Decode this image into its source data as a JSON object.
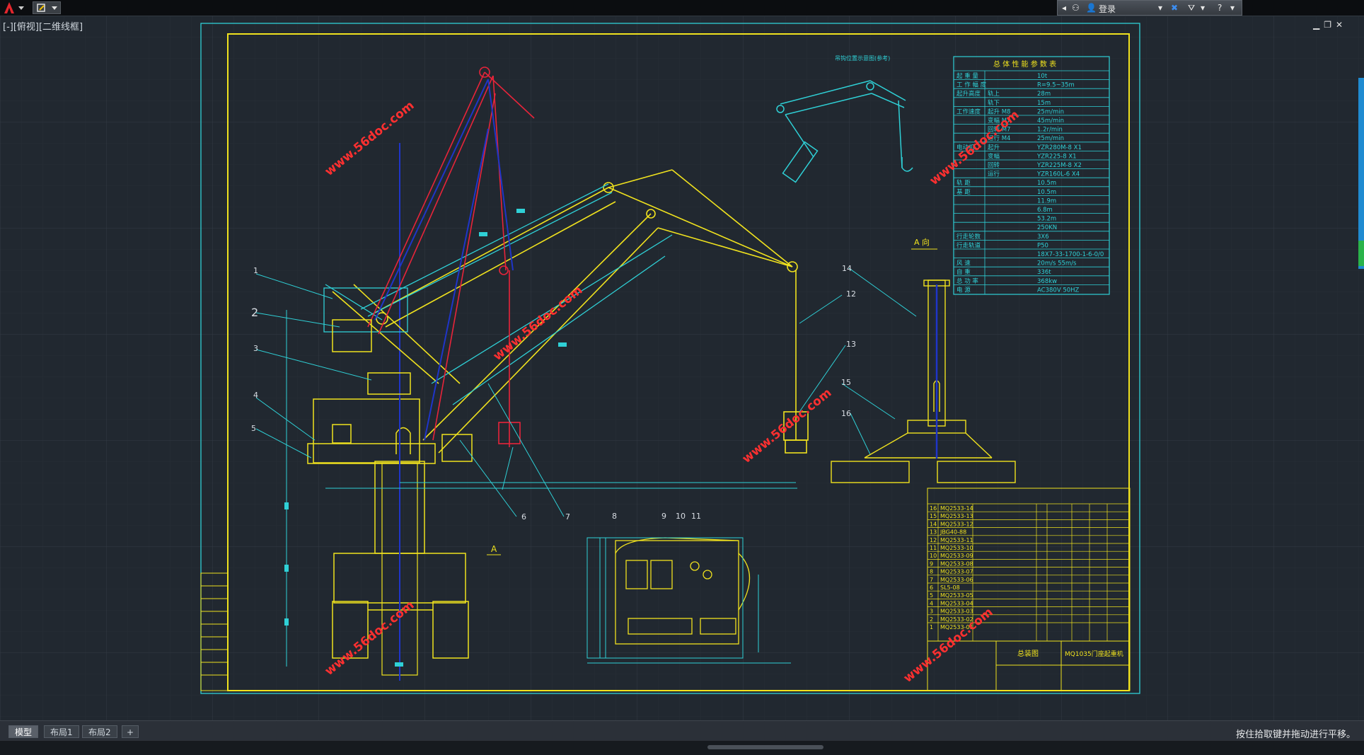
{
  "topbar": {
    "login_label": "登录"
  },
  "viewport": {
    "label": "[-][俯视][二维线框]"
  },
  "watermark": "www.56doc.com",
  "view_a_label": "A 向",
  "section_a_label": "A",
  "detail_title": "吊钩位置示意图(参考)",
  "balloons_left": [
    "1",
    "2",
    "3",
    "4",
    "5",
    "6",
    "7"
  ],
  "balloons_center": [
    "8",
    "9",
    "10",
    "11"
  ],
  "balloons_right": [
    "12",
    "13",
    "14",
    "15",
    "16"
  ],
  "params_table": {
    "title": "总 体 性 能 参 数 表",
    "rows": [
      [
        "起 重 量",
        "",
        "10t"
      ],
      [
        "工 作 幅 度",
        "",
        "R=9.5~35m"
      ],
      [
        "起升高度",
        "轨上",
        "28m"
      ],
      [
        "",
        "轨下",
        "15m"
      ],
      [
        "工作速度",
        "起升 M8",
        "25m/min"
      ],
      [
        "",
        "变幅 M7",
        "45m/min"
      ],
      [
        "",
        "回转 M7",
        "1.2r/min"
      ],
      [
        "",
        "运行 M4",
        "25m/min"
      ],
      [
        "电动机",
        "起升",
        "YZR280M-8 X1"
      ],
      [
        "",
        "变幅",
        "YZR225-8 X1"
      ],
      [
        "",
        "回转",
        "YZR225M-8 X2"
      ],
      [
        "",
        "运行",
        "YZR160L-6 X4"
      ],
      [
        "轨 距",
        "",
        "10.5m"
      ],
      [
        "基 距",
        "",
        "10.5m"
      ],
      [
        "",
        "",
        "11.9m"
      ],
      [
        "",
        "",
        "6.8m"
      ],
      [
        "",
        "",
        "53.2m"
      ],
      [
        "",
        "",
        "250KN"
      ],
      [
        "行走轮数",
        "",
        "3X6"
      ],
      [
        "行走轨道",
        "",
        "P50"
      ],
      [
        "",
        "",
        "18X7-33-1700-1-6-0/0"
      ],
      [
        "风 速",
        "",
        "20m/s  55m/s"
      ],
      [
        "自 重",
        "",
        "336t"
      ],
      [
        "总 功 率",
        "",
        "368kw"
      ],
      [
        "电 源",
        "",
        "AC380V  50HZ"
      ]
    ]
  },
  "bom_table": {
    "rows": [
      [
        "16",
        "MQ2533-14"
      ],
      [
        "15",
        "MQ2533-13"
      ],
      [
        "14",
        "MQ2533-12"
      ],
      [
        "13",
        "JBG40-88"
      ],
      [
        "12",
        "MQ2533-11"
      ],
      [
        "11",
        "MQ2533-10"
      ],
      [
        "10",
        "MQ2533-09"
      ],
      [
        "9",
        "MQ2533-08"
      ],
      [
        "8",
        "MQ2533-07"
      ],
      [
        "7",
        "MQ2533-06"
      ],
      [
        "6",
        "SL5-08"
      ],
      [
        "5",
        "MQ2533-05"
      ],
      [
        "4",
        "MQ2533-04"
      ],
      [
        "3",
        "MQ2533-03"
      ],
      [
        "2",
        "MQ2533-02"
      ],
      [
        "1",
        "MQ2533-01"
      ]
    ],
    "title_block": {
      "drawing_name": "总装图",
      "drawing_no": "MQ1035门座起重机"
    }
  },
  "layout_tabs": [
    "模型",
    "布局1",
    "布局2",
    "+"
  ],
  "status_hint": "按住拾取键并拖动进行平移。",
  "colors": {
    "background": "#212830",
    "grid": "#2c333c",
    "yellow": "#f0e21e",
    "cyan": "#2fd0d6",
    "red": "#e8243a",
    "blue": "#1f35c8",
    "white": "#ffffff",
    "watermark": "#ff2a2a"
  }
}
